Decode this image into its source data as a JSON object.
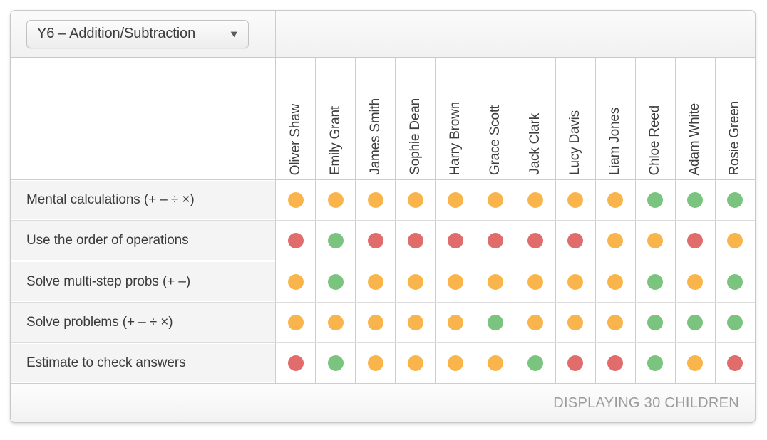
{
  "toolbar": {
    "subject_select": {
      "value": "Y6 – Addition/Subtraction",
      "caret_icon": "chevron-down-icon",
      "caret_glyph": "▼"
    }
  },
  "grid": {
    "children": [
      "Oliver Shaw",
      "Emily Grant",
      "James Smith",
      "Sophie Dean",
      "Harry Brown",
      "Grace Scott",
      "Jack Clark",
      "Lucy Davis",
      "Liam Jones",
      "Chloe Reed",
      "Adam White",
      "Rosie Green"
    ],
    "objectives": [
      "Mental calculations (+ – ÷ ×)",
      "Use the order of operations",
      "Solve multi-step probs (+ –)",
      "Solve problems (+ – ÷ ×)",
      "Estimate to check answers"
    ],
    "status_colors": {
      "green": "#7bc47f",
      "amber": "#f9b54c",
      "red": "#e06c6c"
    },
    "statuses": [
      [
        "amber",
        "amber",
        "amber",
        "amber",
        "amber",
        "amber",
        "amber",
        "amber",
        "amber",
        "green",
        "green",
        "green"
      ],
      [
        "red",
        "green",
        "red",
        "red",
        "red",
        "red",
        "red",
        "red",
        "amber",
        "amber",
        "red",
        "amber"
      ],
      [
        "amber",
        "green",
        "amber",
        "amber",
        "amber",
        "amber",
        "amber",
        "amber",
        "amber",
        "green",
        "amber",
        "green"
      ],
      [
        "amber",
        "amber",
        "amber",
        "amber",
        "amber",
        "green",
        "amber",
        "amber",
        "amber",
        "green",
        "green",
        "green"
      ],
      [
        "red",
        "green",
        "amber",
        "amber",
        "amber",
        "amber",
        "green",
        "red",
        "red",
        "green",
        "amber",
        "red"
      ]
    ]
  },
  "footer": {
    "count_label": "DISPLAYING 30 CHILDREN"
  }
}
